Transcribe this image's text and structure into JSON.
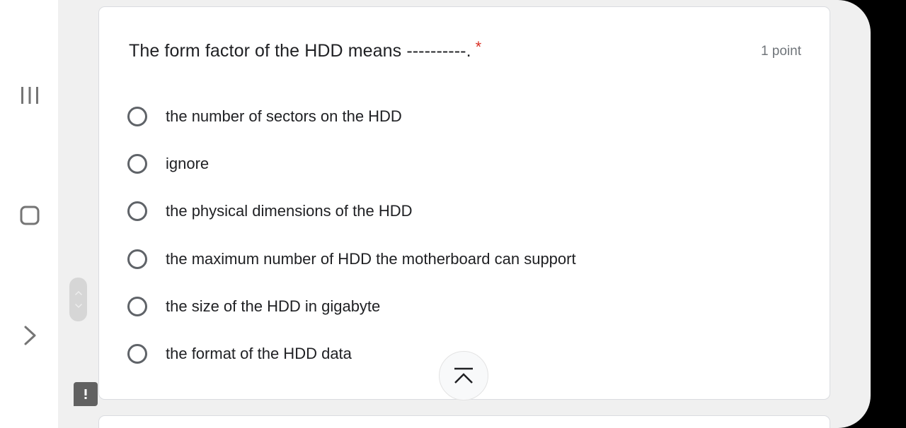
{
  "question": {
    "title": "The form factor of the HDD means ----------.",
    "required_marker": "*",
    "points": "1 point",
    "options": [
      "the number of sectors on the HDD",
      "ignore",
      "the physical dimensions of the HDD",
      "the maximum number of HDD the motherboard can support",
      "the size of the HDD in gigabyte",
      "the format of the HDD data"
    ]
  },
  "colors": {
    "required": "#d93025",
    "text": "#202124",
    "muted": "#70757a",
    "radio_border": "#5f6368",
    "screen_background": "#f0f0f0"
  },
  "icons": {
    "nav_recents": "recents-icon",
    "nav_home": "home-icon",
    "nav_back": "back-icon",
    "scroll": "scroll-handle-icon",
    "feedback": "feedback-icon",
    "scroll_top": "scroll-to-top-icon"
  }
}
